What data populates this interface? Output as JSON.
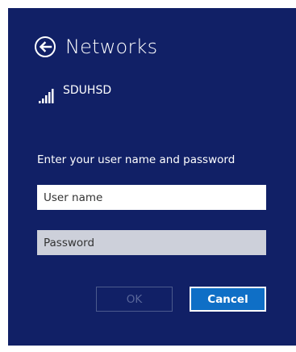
{
  "dialog": {
    "title": "Networks",
    "network_name": "SDUHSD",
    "prompt": "Enter your user name and password",
    "username_placeholder": "User name",
    "username_value": "",
    "password_placeholder": "Password",
    "password_value": "",
    "ok_label": "OK",
    "cancel_label": "Cancel"
  },
  "icons": {
    "back": "back-arrow-circle-icon",
    "signal": "wifi-signal-bars-icon"
  },
  "colors": {
    "panel_background": "#112066",
    "cancel_button": "#0f6fc6",
    "ok_disabled_text": "#59669a",
    "password_field": "#cdd0da"
  }
}
